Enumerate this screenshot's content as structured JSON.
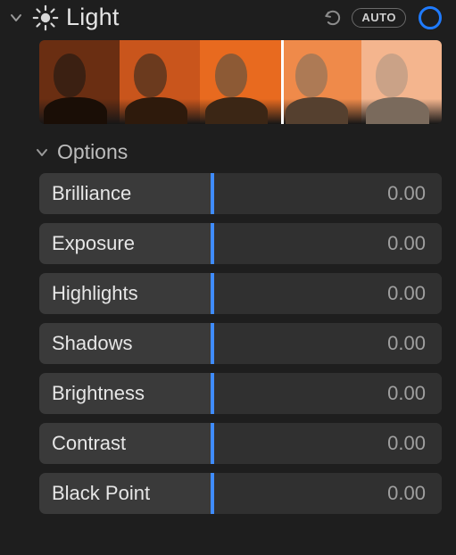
{
  "header": {
    "title": "Light",
    "auto_label": "AUTO"
  },
  "filmstrip": {
    "frames": [
      {
        "bg": "#6a2e12",
        "skin": "#3b2012",
        "shirt": "#1a0e06"
      },
      {
        "bg": "#c9551c",
        "skin": "#6b3a1e",
        "shirt": "#2e1a0c"
      },
      {
        "bg": "#e86a1f",
        "skin": "#8d5a35",
        "shirt": "#3b2615"
      },
      {
        "bg": "#ef8a4a",
        "skin": "#ad7a55",
        "shirt": "#55402f"
      },
      {
        "bg": "#f4b58e",
        "skin": "#caa287",
        "shirt": "#7a6a5c"
      }
    ],
    "divider_after_index": 2
  },
  "options": {
    "label": "Options"
  },
  "sliders": [
    {
      "name": "Brilliance",
      "value": "0.00",
      "pos": 0.43
    },
    {
      "name": "Exposure",
      "value": "0.00",
      "pos": 0.43
    },
    {
      "name": "Highlights",
      "value": "0.00",
      "pos": 0.43
    },
    {
      "name": "Shadows",
      "value": "0.00",
      "pos": 0.43
    },
    {
      "name": "Brightness",
      "value": "0.00",
      "pos": 0.43
    },
    {
      "name": "Contrast",
      "value": "0.00",
      "pos": 0.43
    },
    {
      "name": "Black Point",
      "value": "0.00",
      "pos": 0.43
    }
  ]
}
